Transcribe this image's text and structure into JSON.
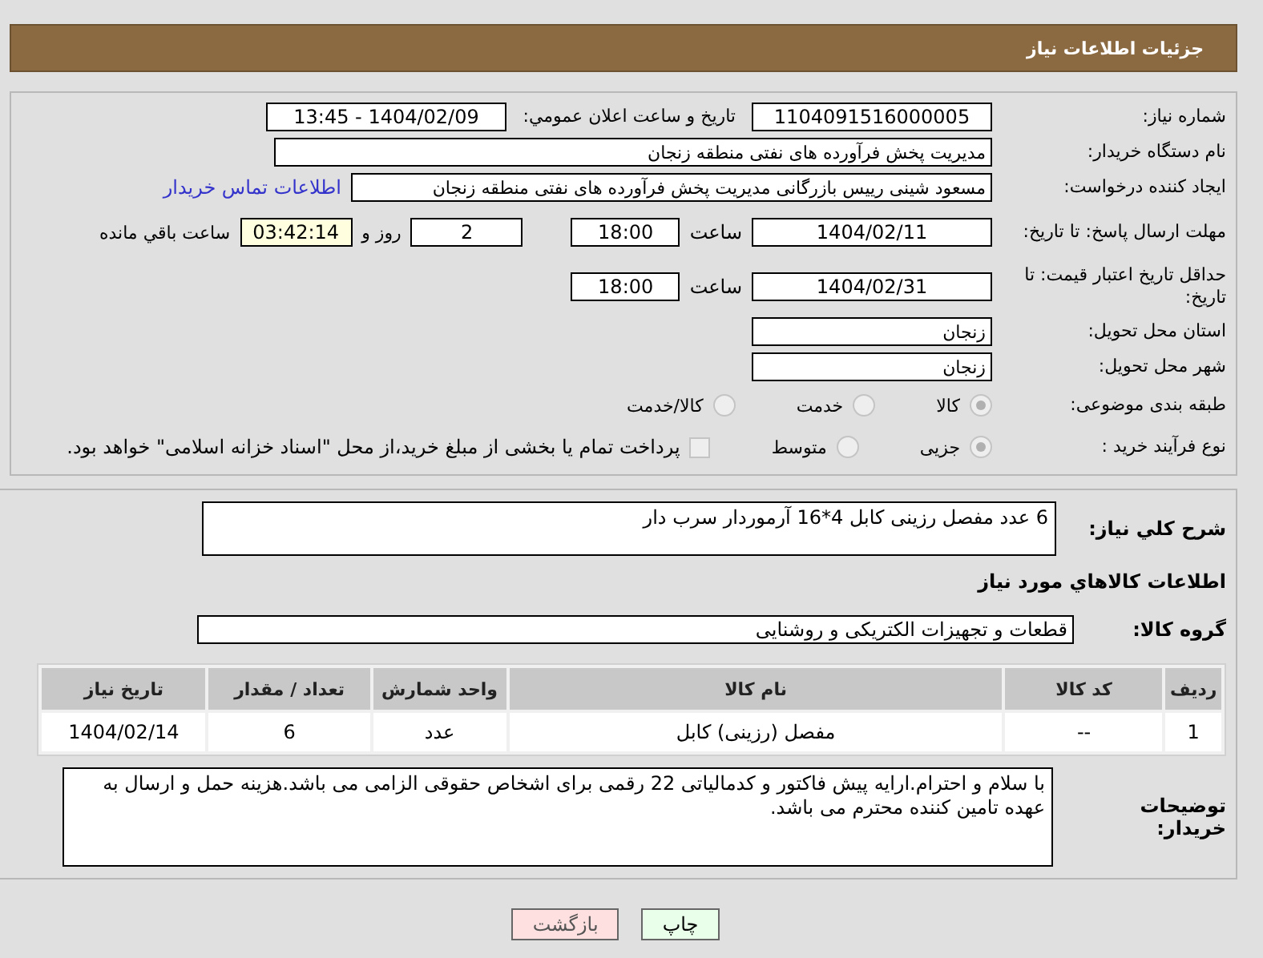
{
  "header": {
    "title": "جزئیات اطلاعات نیاز"
  },
  "need_number": {
    "label": "شماره نیاز:",
    "value": "1104091516000005"
  },
  "announce": {
    "label": "تاریخ و ساعت اعلان عمومي:",
    "value": "1404/02/09 - 13:45"
  },
  "buyer": {
    "label": "نام دستگاه خریدار:",
    "value": "مدیریت پخش فرآورده های نفتی منطقه زنجان"
  },
  "creator": {
    "label": "ایجاد کننده درخواست:",
    "value": "مسعود شینی رییس بازرگانی مدیریت پخش فرآورده های نفتی منطقه زنجان",
    "link": "اطلاعات تماس خریدار"
  },
  "deadline": {
    "label": "مهلت ارسال پاسخ: تا تاریخ:",
    "date": "1404/02/11",
    "time_label": "ساعت",
    "time": "18:00",
    "days": "2",
    "days_label": "روز و",
    "remaining": "03:42:14",
    "remaining_label": "ساعت باقي مانده"
  },
  "validity": {
    "label": "حداقل تاریخ اعتبار قیمت: تا تاریخ:",
    "date": "1404/02/31",
    "time_label": "ساعت",
    "time": "18:00"
  },
  "province": {
    "label": "استان محل تحویل:",
    "value": "زنجان"
  },
  "city": {
    "label": "شهر محل تحویل:",
    "value": "زنجان"
  },
  "category": {
    "label": "طبقه بندی موضوعی:",
    "options": [
      {
        "label": "کالا",
        "selected": true
      },
      {
        "label": "خدمت",
        "selected": false
      },
      {
        "label": "کالا/خدمت",
        "selected": false
      }
    ]
  },
  "process": {
    "label": "نوع فرآیند خرید :",
    "options": [
      {
        "label": "جزیی",
        "selected": true
      },
      {
        "label": "متوسط",
        "selected": false
      }
    ],
    "payment": {
      "label": "پرداخت تمام یا بخشی از مبلغ خرید،از محل \"اسناد خزانه اسلامی\" خواهد بود.",
      "checked": false
    }
  },
  "description": {
    "label": "شرح کلي نیاز:",
    "value": "6 عدد مفصل رزینی کابل 4*16 آرموردار سرب دار"
  },
  "goods_heading": "اطلاعات کالاهاي مورد نیاز",
  "goods_group": {
    "label": "گروه کالا:",
    "value": "قطعات و تجهیزات الکتریکی و روشنایی"
  },
  "table": {
    "columns": [
      "ردیف",
      "کد کالا",
      "نام کالا",
      "واحد شمارش",
      "تعداد / مقدار",
      "تاریخ نیاز"
    ],
    "rows": [
      [
        "1",
        "--",
        "مفصل (رزینی) کابل",
        "عدد",
        "6",
        "1404/02/14"
      ]
    ]
  },
  "notes": {
    "label": "توضیحات خریدار:",
    "value": "با سلام و احترام.ارایه پیش فاکتور و کدمالیاتی 22 رقمی برای اشخاص حقوقی الزامی می باشد.هزینه حمل و ارسال به عهده تامین کننده محترم می باشد."
  },
  "buttons": [
    {
      "label": "چاپ",
      "kind": "print"
    },
    {
      "label": "بازگشت",
      "kind": "back"
    }
  ]
}
